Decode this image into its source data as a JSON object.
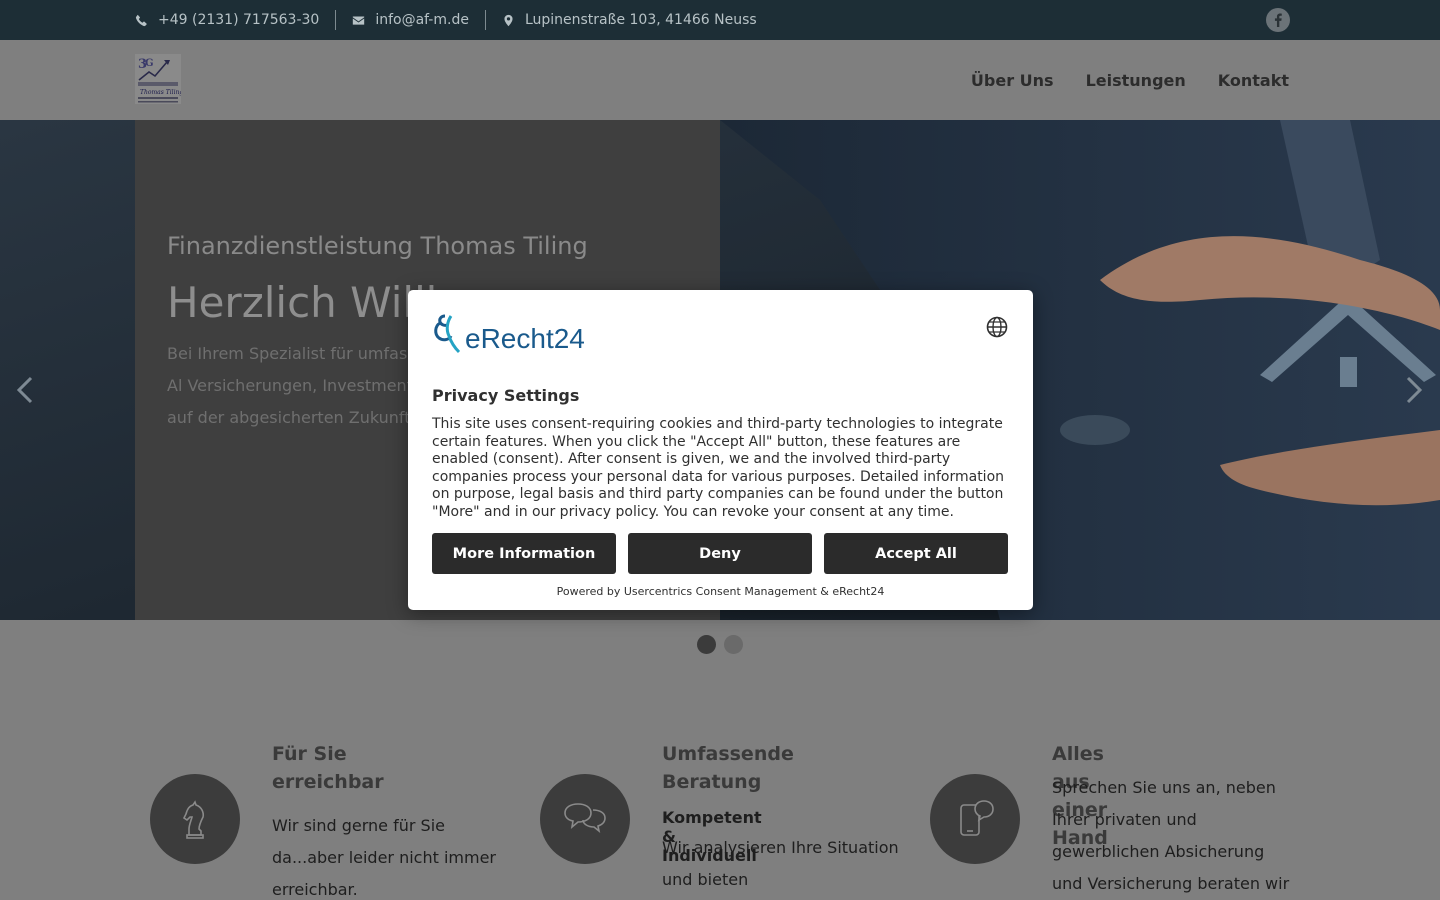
{
  "topbar": {
    "phone": "+49 (2131) 717563-30",
    "email": "info@af-m.de",
    "address": "Lupinenstraße 103, 41466 Neuss",
    "icons": [
      "phone-icon",
      "envelope-icon",
      "map-marker-icon",
      "facebook-icon"
    ]
  },
  "nav": {
    "items": [
      "Über Uns",
      "Leistungen",
      "Kontakt"
    ]
  },
  "hero": {
    "subtitle": "Finanzdienstleistung Thomas Tiling",
    "title": "Herzlich Willk",
    "text": "Bei Ihrem Spezialist für umfasse optimalen Vermögensaufbau. Al Versicherungen, Investment, Bau vertrauensvoller Partner auf der abgesicherten Zukunft."
  },
  "slider": {
    "active_index": 0,
    "dot_count": 2
  },
  "features": [
    {
      "icon": "chess-knight-icon",
      "title_line1": "Für Sie",
      "title_line2": "erreichbar",
      "subtitle": "",
      "text": "Wir sind gerne für Sie da...aber leider nicht immer erreichbar."
    },
    {
      "icon": "speech-bubbles-icon",
      "title_line1": "Umfassende",
      "title_line2": "Beratung",
      "subtitle": "Kompetent & Individuell",
      "text": "Wir analysieren Ihre Situation und bieten maßgeschneiderte"
    },
    {
      "icon": "mobile-chat-icon",
      "title_line1": "Alles aus einer Hand",
      "title_line2": "",
      "subtitle": "",
      "text": "Sprechen Sie uns an, neben Ihrer privaten und gewerblichen Absicherung und Versicherung beraten wir Sie"
    }
  ],
  "consent": {
    "brand": "eRecht24",
    "title": "Privacy Settings",
    "text": "This site uses consent-requiring cookies and third-party technologies to integrate certain features. When you click the \"Accept All\" button, these features are enabled (consent). After consent is given, we and the involved third-party companies process your personal data for various purposes. Detailed information on purpose, legal basis and third party companies can be found under the button \"More\" and in our privacy policy. You can revoke your consent at any time.",
    "more_label": "More Information",
    "deny_label": "Deny",
    "accept_label": "Accept All",
    "powered": "Powered by Usercentrics Consent Management & eRecht24"
  },
  "colors": {
    "topbar_bg": "#1d2e36",
    "overlay_gray": "#7f7f7f",
    "button_dark": "#2b2b2b",
    "brand_blue": "#1a5a8c"
  }
}
